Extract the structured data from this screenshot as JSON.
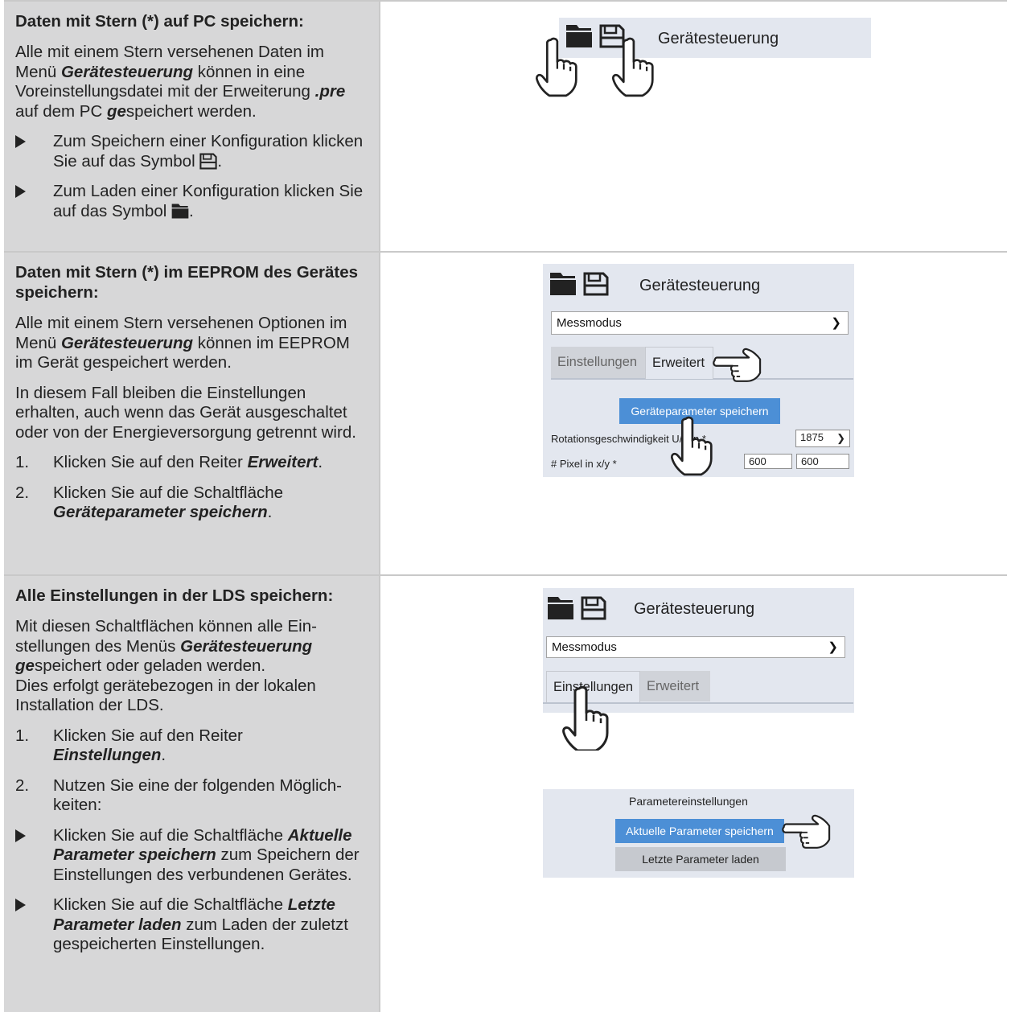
{
  "section1": {
    "heading": "Daten mit Stern (*) auf PC speichern:",
    "para_pre": "Alle mit einem Stern versehenen Daten im Menü ",
    "para_menu": "Gerätesteuerung",
    "para_mid": " können in eine Voreinstellungsdatei mit der Erweiterung ",
    "para_ext": ".pre",
    "para_mid2": " auf dem PC ",
    "para_ge": "ge",
    "para_end": "speichert werden.",
    "bullet1": "Zum Speichern einer Konfiguration klicken Sie auf das Symbol ",
    "bullet2": "Zum Laden einer Konfiguration klicken Sie auf das Symbol ",
    "bullet_end": ".",
    "panel_title": "Gerätesteuerung"
  },
  "section2": {
    "heading": "Daten mit Stern (*) im EEPROM des Gerätes speichern:",
    "para1_pre": "Alle mit einem Stern versehenen Optionen im Menü ",
    "para1_menu": "Gerätesteuerung",
    "para1_end": " können im EEPROM im Gerät gespeichert werden.",
    "para2": "In diesem Fall bleiben die Einstellungen erhalten, auch wenn das Gerät ausge­schaltet oder von der Energieversorgung getrennt wird.",
    "step1_num": "1.",
    "step1_pre": "Klicken Sie auf den Reiter ",
    "step1_bold": "Erweitert",
    "step1_end": ".",
    "step2_num": "2.",
    "step2_pre": "Klicken Sie auf die Schaltfläche ",
    "step2_bold": "Geräteparameter speichern",
    "step2_end": ".",
    "panel_title": "Gerätesteuerung",
    "dropdown": "Messmodus",
    "tab_settings": "Einstellungen",
    "tab_advanced": "Erweitert",
    "save_button": "Geräteparameter speichern",
    "rot_label": "Rotationsgeschwindigkeit U/min *",
    "rot_value": "1875",
    "pixel_label": "# Pixel in x/y *",
    "pixel_x": "600",
    "pixel_y": "600"
  },
  "section3": {
    "heading": "Alle Einstellungen in der LDS speichern:",
    "para_pre": "Mit diesen Schaltflächen können alle Ein­stellungen des Menüs ",
    "para_menu": "Gerätesteuerung",
    "para_ge": "ge",
    "para_mid": "speichert oder geladen werden.",
    "para_line2": "Dies erfolgt gerätebezogen in der lokalen Installation der LDS.",
    "step1_num": "1.",
    "step1_pre": "Klicken Sie auf den Reiter ",
    "step1_bold": "Einstellungen",
    "step1_end": ".",
    "step2_num": "2.",
    "step2_text": "Nutzen Sie eine der folgenden Möglich­keiten:",
    "b1_pre": "Klicken Sie auf die Schaltfläche ",
    "b1_bold": "Aktuelle Parameter speichern",
    "b1_end": " zum Speichern der Einstellungen des ver­bundenen Gerätes.",
    "b2_pre": "Klicken Sie auf die Schaltfläche ",
    "b2_bold": "Letzte Parameter laden",
    "b2_end": " zum Laden der zuletzt gespeicherten Einstellungen.",
    "panel_title": "Gerätesteuerung",
    "dropdown": "Messmodus",
    "tab_settings": "Einstellungen",
    "tab_advanced": "Erweitert",
    "params_title": "Parametereinstellungen",
    "save_current": "Aktuelle Parameter speichern",
    "load_last": "Letzte Parameter laden"
  },
  "colors": {
    "left_bg": "#d7d7d8",
    "panel_bg": "#e3e7ef",
    "accent": "#4c8fd6"
  }
}
